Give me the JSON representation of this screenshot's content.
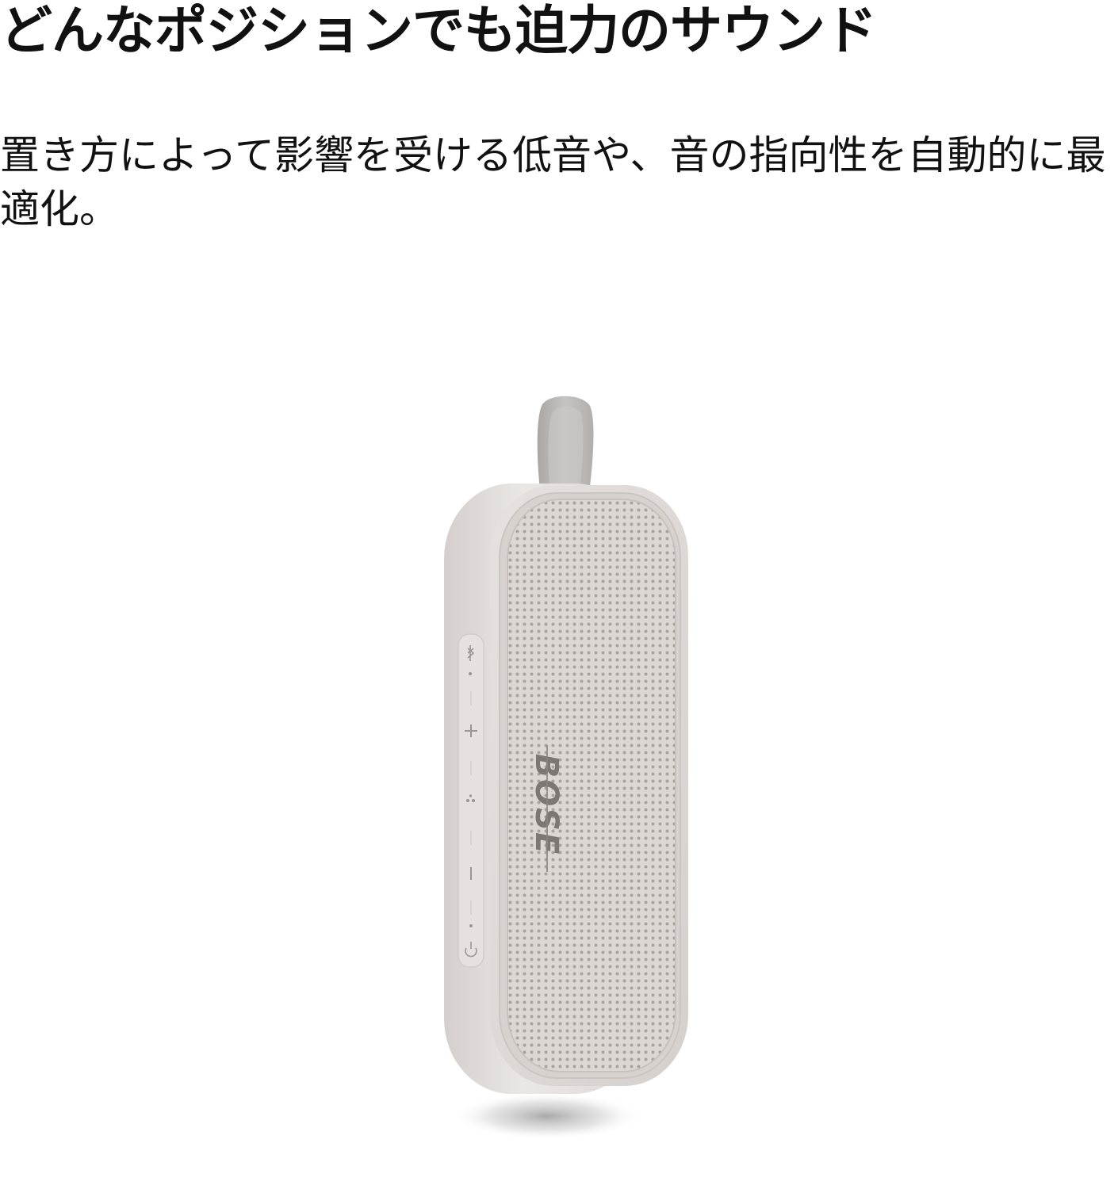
{
  "headline": "どんなポジションでも迫力のサウンド",
  "subcopy": "置き方によって影響を受ける低音や、音の指向性を自動的に最適化。",
  "product": {
    "logo_text": "BOSE",
    "body_color": "#e3dedb",
    "grille_color": "#d9d3d0",
    "strap_color": "#b8b5b2",
    "buttons": [
      "bluetooth-icon",
      "plus-icon",
      "multifunction-icon",
      "minus-icon",
      "power-icon"
    ]
  }
}
